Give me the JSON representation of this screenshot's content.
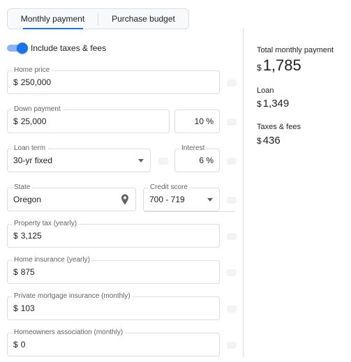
{
  "tabs": [
    {
      "label": "Monthly payment",
      "active": true
    },
    {
      "label": "Purchase budget",
      "active": false
    }
  ],
  "toggle": {
    "label": "Include taxes & fees",
    "on": true
  },
  "currency_symbol": "$",
  "fields": {
    "home_price": {
      "label": "Home price",
      "value": "250,000"
    },
    "down_payment": {
      "label": "Down payment",
      "value": "25,000"
    },
    "down_payment_percent": {
      "value": "10 %"
    },
    "loan_term": {
      "label": "Loan term",
      "value": "30-yr fixed"
    },
    "interest": {
      "label": "Interest",
      "value": "6 %"
    },
    "state": {
      "label": "State",
      "value": "Oregon"
    },
    "credit_score": {
      "label": "Credit score",
      "value": "700 - 719"
    },
    "property_tax": {
      "label": "Property tax (yearly)",
      "value": "3,125"
    },
    "home_insurance": {
      "label": "Home insurance (yearly)",
      "value": "875"
    },
    "pmi": {
      "label": "Private mortgage insurance (monthly)",
      "value": "103"
    },
    "hoa": {
      "label": "Homeowners association (monthly)",
      "value": "0"
    }
  },
  "summary": {
    "total": {
      "label": "Total monthly payment",
      "value": "1,785"
    },
    "loan": {
      "label": "Loan",
      "value": "1,349"
    },
    "taxes": {
      "label": "Taxes & fees",
      "value": "436"
    }
  },
  "colors": {
    "accent": "#1a73e8",
    "border": "#dadce0"
  },
  "icons": {
    "state_field": "location-pin-icon",
    "dropdown": "chevron-down-icon"
  }
}
